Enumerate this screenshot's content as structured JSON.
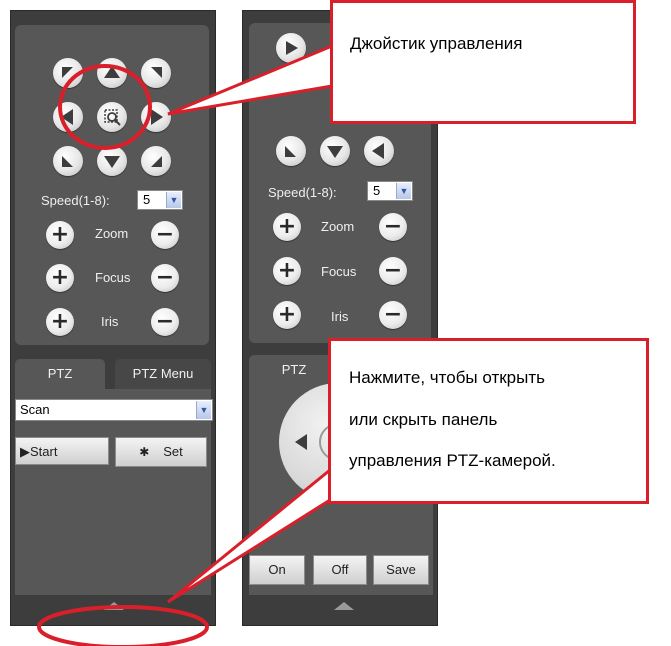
{
  "left_panel": {
    "speed_label": "Speed(1-8):",
    "speed_value": "5",
    "zoom_label": "Zoom",
    "focus_label": "Focus",
    "iris_label": "Iris",
    "tab_ptz": "PTZ",
    "tab_ptz_menu": "PTZ Menu",
    "scan_value": "Scan",
    "start_label": "▶Start",
    "set_label": "Set"
  },
  "right_panel": {
    "speed_label": "Speed(1-8):",
    "speed_value": "5",
    "zoom_label": "Zoom",
    "focus_label": "Focus",
    "iris_label": "Iris",
    "tab_ptz": "PTZ",
    "on_label": "On",
    "off_label": "Off",
    "save_label": "Save"
  },
  "callouts": {
    "joystick": "Джойстик управления",
    "toggle_line1": "Нажмите, чтобы открыть",
    "toggle_line2": "или скрыть панель",
    "toggle_line3": "управления PTZ-камерой."
  },
  "colors": {
    "panel": "#3d3d3d",
    "inner": "#575757",
    "highlight": "#d9202a"
  }
}
